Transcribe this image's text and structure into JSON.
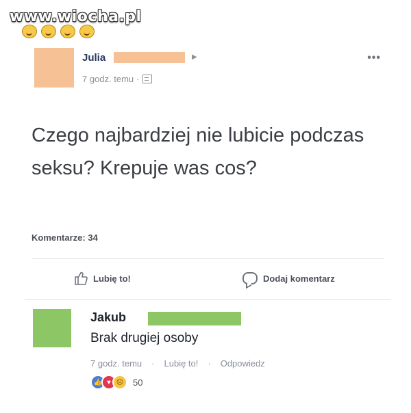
{
  "watermark": {
    "text": "www.wiocha.pl"
  },
  "post": {
    "author": "Julia",
    "time": "7 godz. temu",
    "separator": "·",
    "more_label": "•••",
    "text": "Czego najbardziej nie lubicie podczas seksu? Krepuje was cos?",
    "comments_count": "Komentarze: 34",
    "like_label": "Lubię to!",
    "comment_label": "Dodaj komentarz"
  },
  "comment": {
    "author": "Jakub",
    "text": "Brak drugiej osoby",
    "time": "7 godz. temu",
    "like_label": "Lubię to!",
    "reply_label": "Odpowiedz",
    "sep": "·",
    "reactions_count": "50"
  },
  "colors": {
    "post_avatar": "#f6c295",
    "comment_avatar": "#8cc665",
    "reaction_like": "#4d7cd6",
    "reaction_love": "#e0364f",
    "reaction_sad": "#f5c542"
  }
}
